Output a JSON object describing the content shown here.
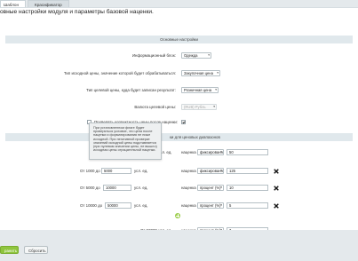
{
  "tabs": [
    {
      "label": "Шаблон",
      "active": true
    },
    {
      "label": "Красификатор",
      "active": false
    }
  ],
  "page_title": "овные настройки модуля и параметры базовой наценки.",
  "main_section": {
    "title": "Основные настройки",
    "rows": [
      {
        "label": "Информационный блок:",
        "value": "Одежда"
      },
      {
        "label": "Тип исходной цены, значение которой будет обрабатываться:",
        "value": "Закупочная цена"
      },
      {
        "label": "Тип целевой цены, куда будет записан результат:",
        "value": "Розничная цена"
      },
      {
        "label": "Валюта целевой цены:",
        "value": "(RUB) Рубль"
      }
    ],
    "check_label": "Проверять корректность цены после наценки:",
    "check_checked": true
  },
  "tooltip_text": "При установленном флаге будет проверяться условие, что цена после наценки и форматирования не ниже исходной. При негативной проверке значений исходной цены подставляется (при нулевом значении цены, не вышло) исходная цены отрицательной наценки.",
  "ranges_section": {
    "title": "ки для ценовых диапазонов",
    "rows": [
      {
        "from_label": "",
        "from": "",
        "to_label": "усл. ед.",
        "markup_label": "наценка",
        "type": "фиксированная",
        "value": "50",
        "deletable": false
      },
      {
        "from_label": "От 1000 до",
        "from": "5000",
        "to_label": "усл. ед.",
        "markup_label": "наценка",
        "type": "фиксированная",
        "value": "125",
        "deletable": true
      },
      {
        "from_label": "От 5000 до",
        "from": "10000",
        "to_label": "усл. ед.",
        "markup_label": "наценка",
        "type": "процент (%)",
        "value": "10",
        "deletable": true
      },
      {
        "from_label": "От 10000 до",
        "from": "50000",
        "to_label": "усл. ед.",
        "markup_label": "наценка",
        "type": "процент (%)",
        "value": "5",
        "deletable": true
      }
    ],
    "last_row": {
      "label": "От 50000 усл. ед.",
      "markup_label": "наценка",
      "type": "процент (%)",
      "value": "3"
    }
  },
  "buttons": {
    "save": "ранить",
    "reset": "Сбросить"
  },
  "colors": {
    "save": "#8fc53e",
    "add": "#9bcd4a",
    "delete": "#111111",
    "header": "#e0e8ec"
  }
}
